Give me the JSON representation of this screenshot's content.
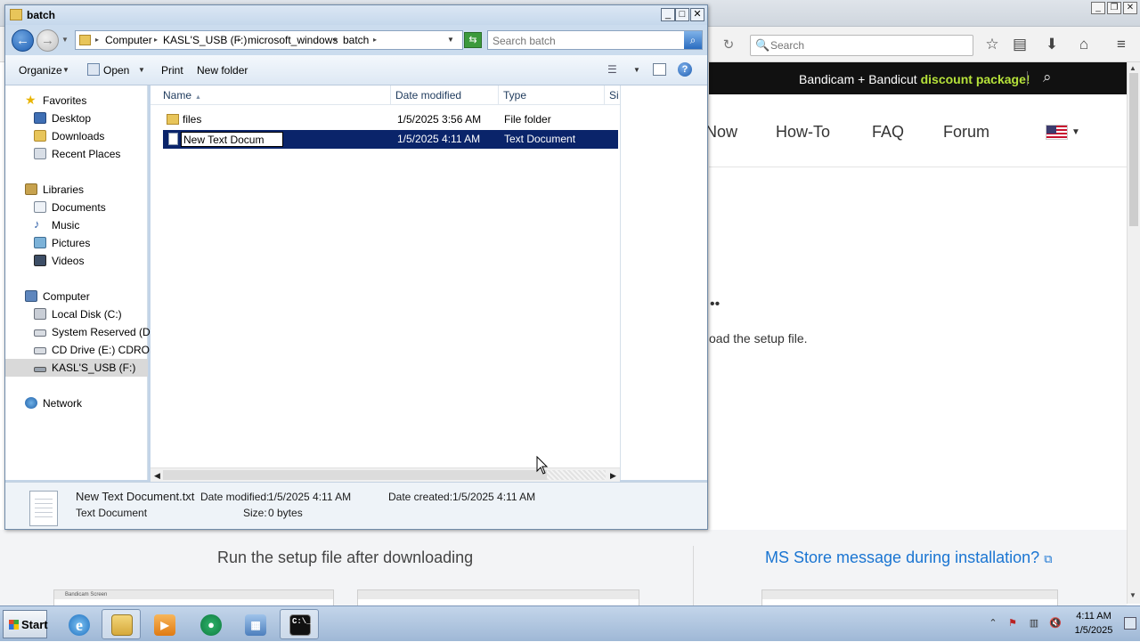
{
  "browser": {
    "search_placeholder": "Search",
    "banner": {
      "text": "Bandicam + Bandicut ",
      "highlight": "discount package!"
    },
    "nav": [
      "Now",
      "How-To",
      "FAQ",
      "Forum"
    ],
    "content_dots": "••",
    "content_text": "oad the setup file.",
    "section": {
      "heading": "Run the setup file after downloading",
      "link": "MS Store message during installation?",
      "thumb_title": "Bandicam Screen"
    }
  },
  "explorer": {
    "title": "batch",
    "breadcrumb": [
      "Computer",
      "KASL'S_USB (F:)",
      "microsoft_windows",
      "batch"
    ],
    "search_placeholder": "Search batch",
    "commands": {
      "organize": "Organize",
      "open": "Open",
      "print": "Print",
      "new_folder": "New folder"
    },
    "nav_pane": {
      "favorites": "Favorites",
      "favorites_items": [
        "Desktop",
        "Downloads",
        "Recent Places"
      ],
      "libraries": "Libraries",
      "libraries_items": [
        "Documents",
        "Music",
        "Pictures",
        "Videos"
      ],
      "computer": "Computer",
      "computer_items": [
        "Local Disk (C:)",
        "System Reserved (D:)",
        "CD Drive (E:) CDROM",
        "KASL'S_USB (F:)"
      ],
      "network": "Network",
      "selected": "KASL'S_USB (F:)"
    },
    "columns": [
      "Name",
      "Date modified",
      "Type",
      "Si"
    ],
    "files": [
      {
        "name": "files",
        "date_modified": "1/5/2025 3:56 AM",
        "type": "File folder",
        "icon": "folder-icon"
      },
      {
        "name": "New Text Docum",
        "date_modified": "1/5/2025 4:11 AM",
        "type": "Text Document",
        "icon": "text-document-icon",
        "selected": true,
        "renaming": true
      }
    ],
    "details": {
      "file_name": "New Text Document.txt",
      "file_type": "Text Document",
      "date_modified_label": "Date modified:",
      "date_modified": "1/5/2025 4:11 AM",
      "date_created_label": "Date created:",
      "date_created": "1/5/2025 4:11 AM",
      "size_label": "Size:",
      "size": "0 bytes"
    }
  },
  "taskbar": {
    "start_label": "Start",
    "apps": [
      "internet-explorer-icon",
      "file-explorer-icon",
      "media-player-icon",
      "bandicam-icon",
      "control-panel-icon",
      "command-prompt-icon"
    ],
    "clock_time": "4:11 AM",
    "clock_date": "1/5/2025"
  },
  "colors": {
    "selection": "#0a246a",
    "banner_highlight": "#b6e23a",
    "link": "#1a75d2"
  }
}
